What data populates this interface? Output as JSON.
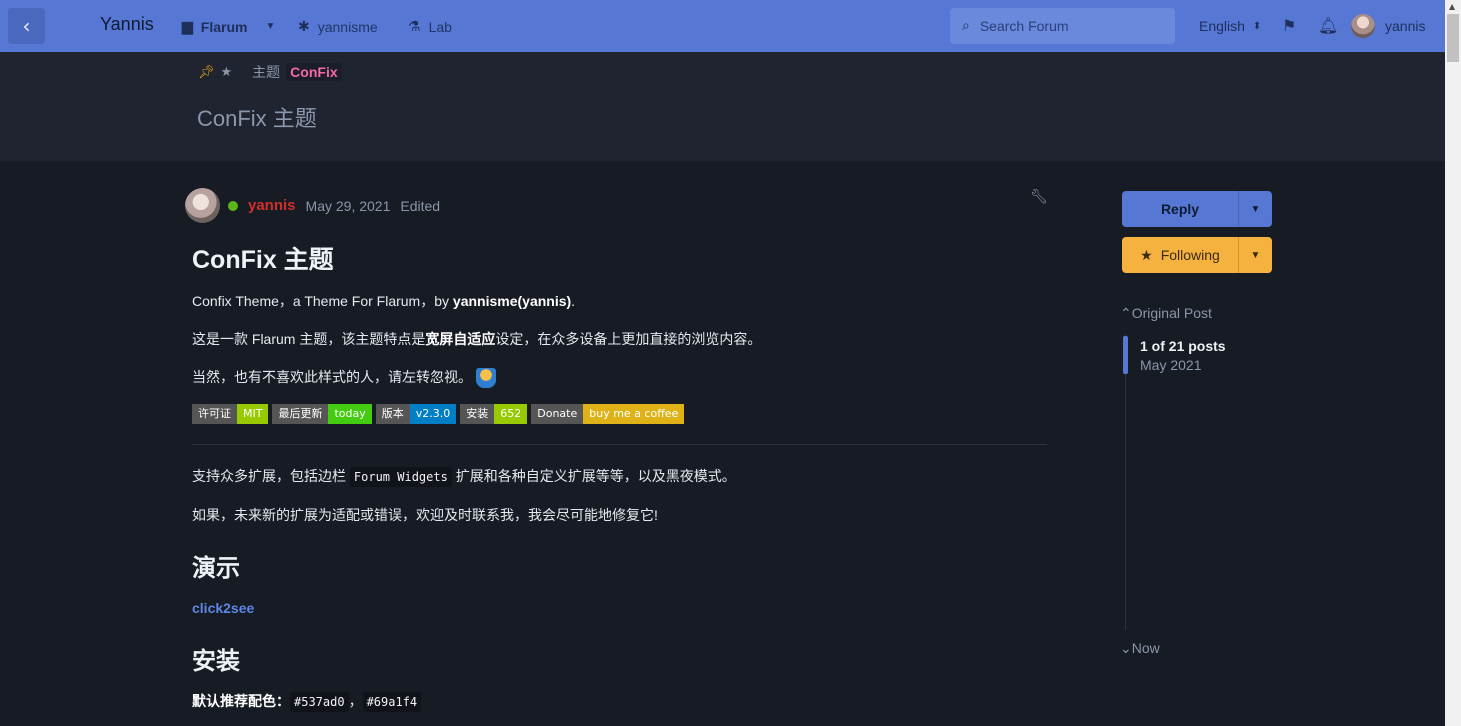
{
  "header": {
    "brand": "Yannis",
    "nav": [
      {
        "label": "Flarum"
      },
      {
        "label": "yannisme"
      },
      {
        "label": "Lab"
      }
    ],
    "search_placeholder": "Search Forum",
    "language": "English",
    "user": "yannis"
  },
  "hero": {
    "tag_theme": "主题",
    "tag_confix": "ConFix",
    "title": "ConFix 主题"
  },
  "post": {
    "author": "yannis",
    "date": "May 29, 2021",
    "edited": "Edited",
    "heading": "ConFix 主题",
    "line1_pre": "Confix Theme，a Theme For Flarum，by ",
    "line1_bold": "yannisme(yannis)",
    "line1_post": ".",
    "line2_pre": "这是一款 Flarum 主题，该主题特点是",
    "line2_bold": "宽屏自适应",
    "line2_post": "设定，在众多设备上更加直接的浏览内容。",
    "line3": "当然，也有不喜欢此样式的人，请左转忽视。",
    "badges": [
      {
        "left": "许可证",
        "right": "MIT",
        "color": "#97ca00"
      },
      {
        "left": "最后更新",
        "right": "today",
        "color": "#4c1"
      },
      {
        "left": "版本",
        "right": "v2.3.0",
        "color": "#007ec6"
      },
      {
        "left": "安装",
        "right": "652",
        "color": "#97ca00"
      },
      {
        "left": "Donate",
        "right": "buy me a coffee",
        "color": "#dfb317"
      }
    ],
    "line4_pre": "支持众多扩展，包括边栏 ",
    "line4_code": "Forum Widgets",
    "line4_post": " 扩展和各种自定义扩展等等，以及黑夜模式。",
    "line5": "如果，未来新的扩展为适配或错误，欢迎及时联系我，我会尽可能地修复它!",
    "demo_heading": "演示",
    "demo_link": "click2see",
    "install_heading": "安装",
    "color_label": "默认推荐配色：",
    "color_code1": "#537ad0",
    "color_sep": "，",
    "color_code2": "#69a1f4"
  },
  "sidebar": {
    "reply": "Reply",
    "following": "Following",
    "original_post": "Original Post",
    "count": "1 of 21 posts",
    "month": "May 2021",
    "now": "Now"
  },
  "colors": {
    "header": "#5678d4",
    "accent_pink": "#f269a8",
    "author_red": "#d0302a",
    "following_yellow": "#f5b23f"
  }
}
